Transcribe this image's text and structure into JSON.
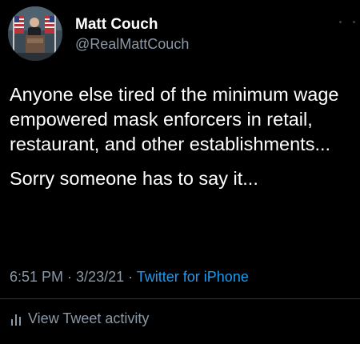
{
  "colors": {
    "background": "#000000",
    "primary_text": "#ffffff",
    "secondary_text": "#8b98a5",
    "link": "#1d9bf0",
    "divider": "#2f3336"
  },
  "author": {
    "name": "Matt Couch",
    "handle": "@RealMattCouch",
    "avatar_icon": "profile-photo-podium-flags"
  },
  "header": {
    "more_icon": "more-dots-icon"
  },
  "tweet": {
    "text_line_1": "Anyone else tired of the minimum wage empowered mask enforcers in retail, restaurant, and other establishments...",
    "text_line_2": "Sorry someone has to say it..."
  },
  "meta": {
    "time": "6:51 PM",
    "separator_1": " · ",
    "date": "3/23/21",
    "separator_2": " · ",
    "source": "Twitter for iPhone"
  },
  "activity": {
    "icon": "bar-chart-icon",
    "label": "View Tweet activity"
  }
}
